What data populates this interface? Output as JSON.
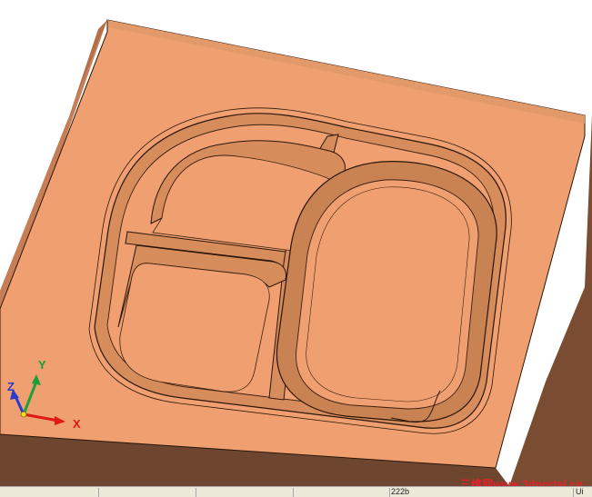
{
  "viewport": {
    "triad": {
      "z_label": "Z",
      "y_label": "Y",
      "x_label": "X"
    },
    "colors": {
      "part_face": "#f0a070",
      "part_side_left": "#b46e48",
      "part_side_right": "#7a4c32",
      "part_front": "#6e4630",
      "edge": "#2a1608",
      "axis_x": "#e01818",
      "axis_y": "#18a03a",
      "axis_z": "#2a3bd0"
    }
  },
  "watermark": {
    "text": "三维网www.3dportal.cn"
  },
  "statusbar": {
    "coords": "222b",
    "units": "Ui"
  }
}
